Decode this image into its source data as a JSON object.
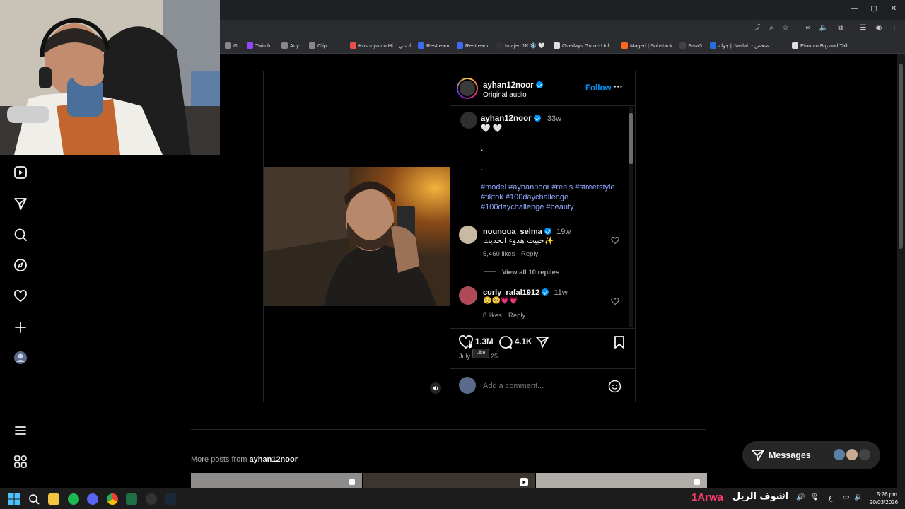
{
  "bookmarks": [
    {
      "label": "G",
      "color": "#888"
    },
    {
      "label": "Twitch",
      "color": "#9146ff"
    },
    {
      "label": "Any",
      "color": "#888"
    },
    {
      "label": "Clip",
      "color": "#888"
    },
    {
      "label": "Kusunya no Hi... انسي",
      "color": "#e84e4e"
    },
    {
      "label": "Restream",
      "color": "#3d6cf0"
    },
    {
      "label": "Restream",
      "color": "#3d6cf0"
    },
    {
      "label": "Imajed 1K ❄️ 🤍",
      "color": "#333"
    },
    {
      "label": "Overlays.Guru - Unl...",
      "color": "#ddd"
    },
    {
      "label": "Maged | Substack",
      "color": "#ff6719"
    },
    {
      "label": "Sara3",
      "color": "#444"
    },
    {
      "label": "جولة | Jawlah - متحص",
      "color": "#2b6be0"
    },
    {
      "label": "Efomao Big and Tall...",
      "color": "#ddd"
    }
  ],
  "post": {
    "author": "ayhan12noor",
    "audio": "Original audio",
    "follow": "Follow",
    "more": "···",
    "caption_author": "ayhan12noor",
    "caption_time": "33w",
    "caption_line1": "🤍 🤍",
    "dot1": ".",
    "dot2": ".",
    "hashtags_line1": "#model #ayhannoor #reels #streetstyle",
    "hashtags_line2": "#tiktok #100daychallenge",
    "hashtags_line3": "#100daychallenge #beauty",
    "comments": [
      {
        "user": "nounoua_selma",
        "time": "19w",
        "text": "حبيت هدوء الحديث✨",
        "likes": "5,460 likes",
        "reply": "Reply"
      },
      {
        "user": "curly_rafal1912",
        "time": "11w",
        "text": "🥺🥺💗💗",
        "likes": "8 likes",
        "reply": "Reply"
      }
    ],
    "view_replies": "View all 10 replies",
    "like_count": "1.3M",
    "comment_count": "4.1K",
    "date_left": "July",
    "date_right": "25",
    "tooltip": "Like",
    "add_comment_placeholder": "Add a comment..."
  },
  "more_posts_prefix": "More posts from",
  "more_posts_user": "ayhan12noor",
  "messages_label": "Messages",
  "taskbar": {
    "arwa": "1Arwa",
    "arabic": "اشوف الريل",
    "lang": "ع",
    "time": "5:26 pm",
    "date": "20/03/2026"
  }
}
